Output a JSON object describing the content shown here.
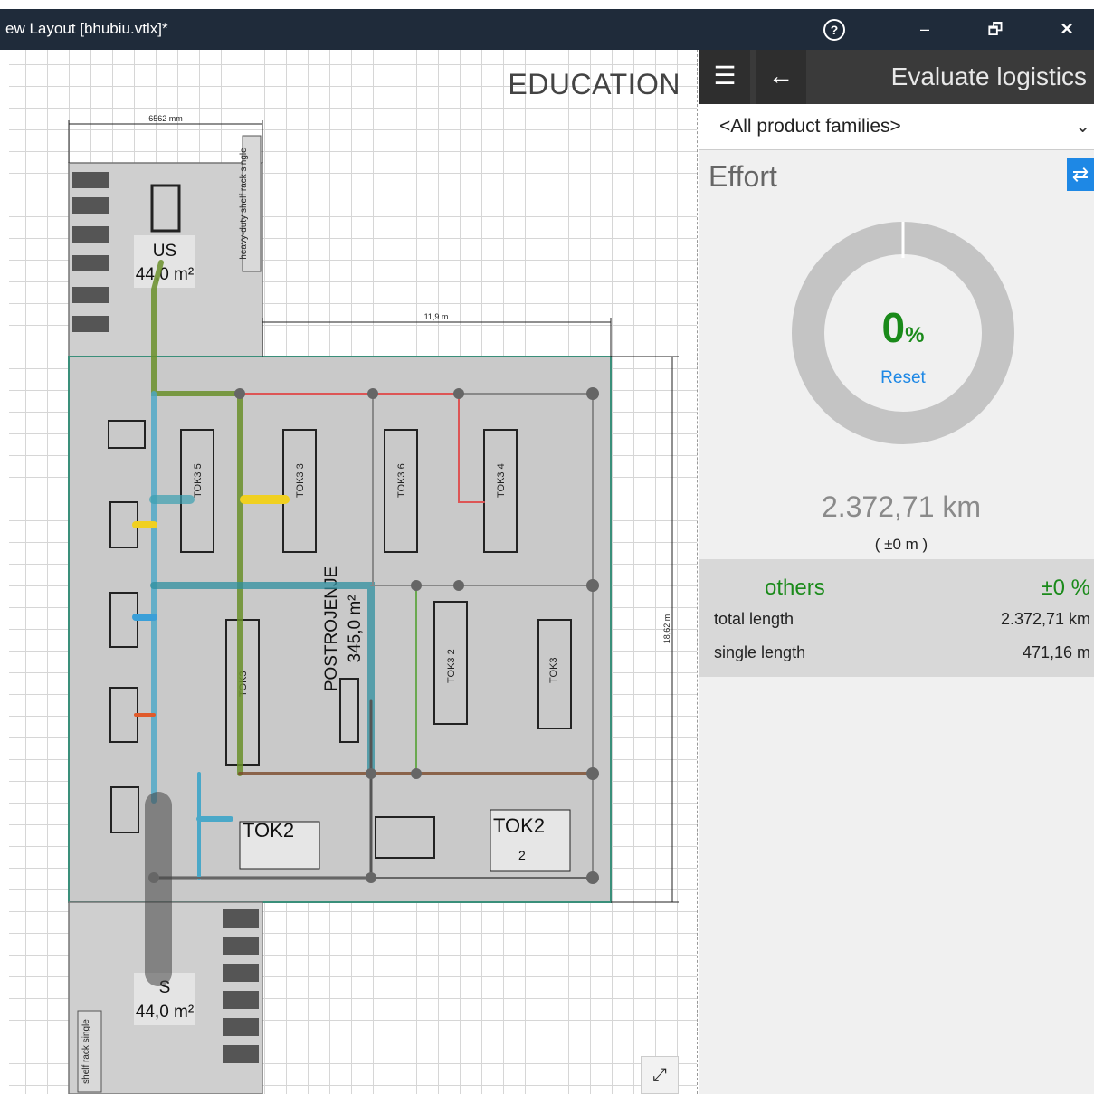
{
  "window": {
    "title": "ew Layout [bhubiu.vtlx]*",
    "help_glyph": "?",
    "minimize_glyph": "‒",
    "restore_glyph": "🗗",
    "close_glyph": "✕"
  },
  "canvas": {
    "watermark": "EDUCATION",
    "dim_top_width": "6562 mm",
    "dim_mid_width": "11,9 m",
    "dim_right_height": "18,62 m",
    "room_top_name": "US",
    "room_top_area": "44,0 m²",
    "room_main_name": "POSTROJENJE",
    "room_main_area": "345,0 m²",
    "room_bottom_name": "S",
    "room_bottom_area": "44,0 m²",
    "rack_top_label": "heavy-duty shelf rack single",
    "rack_bottom_label": "shelf rack single",
    "machine_labels": [
      "TOK3 5",
      "TOK3 3",
      "TOK3 6",
      "TOK3 4",
      "TOK3",
      "TOK3 2",
      "TOK3"
    ],
    "tok2_left": "TOK2",
    "tok2_right": "TOK2",
    "tok2_right_num": "2",
    "expand_glyph": "⤢"
  },
  "panel": {
    "title": "Evaluate logistics",
    "menu_glyph": "☰",
    "back_glyph": "←",
    "product_family": "<All product families>",
    "chevron_glyph": "⌄",
    "section_label": "Effort",
    "swap_glyph": "⇄",
    "percent_value": "0",
    "percent_symbol": "%",
    "reset_label": "Reset",
    "total_distance": "2.372,71 km",
    "total_delta": "( ±0 m )",
    "donut_fraction": 1.0,
    "others": {
      "name": "others",
      "percent": "±0 %",
      "total_length_label": "total length",
      "total_length_value": "2.372,71 km",
      "single_length_label": "single length",
      "single_length_value": "471,16 m"
    }
  },
  "colors": {
    "accent_blue": "#1e88e5",
    "ok_green": "#1a8a1a",
    "title_bar": "#1f2b3a"
  }
}
